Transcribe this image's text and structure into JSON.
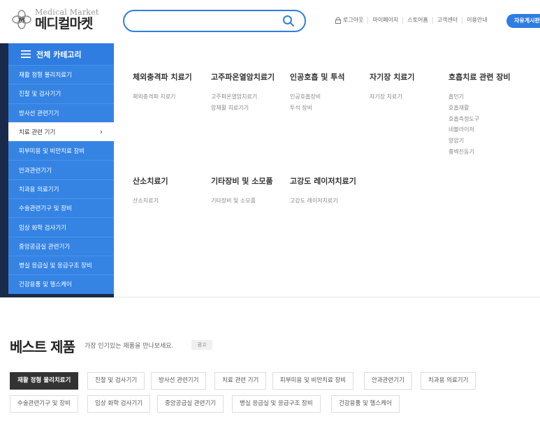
{
  "header": {
    "logo_en": "Medical Market",
    "logo_ko": "메디컬마켓",
    "search_placeholder": "",
    "util": [
      "로그아웃",
      "마이페이지",
      "스토어홈",
      "고객센터",
      "이용안내"
    ],
    "free_board": "자유게시판"
  },
  "sidebar": {
    "title": "전체 카테고리",
    "categories": [
      "재활 정형 물리치료기",
      "진찰 및 검사기기",
      "방사선 관련기기",
      "치료 관련 기기",
      "피부미용 및 비만치료 장비",
      "안과관련기기",
      "치과용 의료기기",
      "수술관련기구 및 장비",
      "임상 화학 검사기기",
      "중앙공급실 관련기기",
      "병실 응급실 및 응급구조 장비",
      "건강용품 및 헬스케어"
    ],
    "active_arrow": "›"
  },
  "mega": {
    "columns": [
      {
        "title": "체외충격파 치료기",
        "items": [
          "체외충격파 치료기"
        ]
      },
      {
        "title": "고주파온열암치료기",
        "items": [
          "고주파온열암치료기",
          "암재활 치료기기"
        ]
      },
      {
        "title": "인공호흡 및 투석",
        "items": [
          "인공호흡장비",
          "투석 장비"
        ]
      },
      {
        "title": "자기장 치료기",
        "items": [
          "자기장 치료기"
        ]
      },
      {
        "title": "호흡치료 관련 장비",
        "items": [
          "흡인기",
          "호흡재활",
          "호흡측정도구",
          "네뷸라이저",
          "양압기",
          "흉벽진동기"
        ]
      },
      {
        "title": "산소치료기",
        "items": [
          "산소치료기"
        ]
      },
      {
        "title": "기타장비 및 소모품",
        "items": [
          "기타장비 및 소모품"
        ]
      },
      {
        "title": "고강도 레이저치료기",
        "items": [
          "고강도 레이저치료기"
        ]
      }
    ]
  },
  "best": {
    "title": "베스트 제품",
    "subtitle": "가장 인기있는 제품을 만나보세요.",
    "ad": "광고",
    "tabs": [
      "재활 정형 물리치료기",
      "진찰 및 검사기기",
      "방사선 관련기기",
      "치료 관련 기기",
      "피부미용 및 비만치료 장비",
      "안과관련기기",
      "치과용 의료기기",
      "수술관련기구 및 장비",
      "임상 화학 검사기기",
      "중앙공급실 관련기기",
      "병실 응급실 및 응급구조 장비",
      "건강용품 및 헬스케어"
    ]
  },
  "colors": {
    "accent": "#2f7de1",
    "sidebar_item": "#3584e4",
    "sidebar_dark": "#1a2a4a",
    "tab_active": "#333333"
  },
  "icons": [
    "logo-emblem-icon",
    "search-icon",
    "lock-icon",
    "hamburger-menu-icon",
    "chevron-right-icon"
  ]
}
